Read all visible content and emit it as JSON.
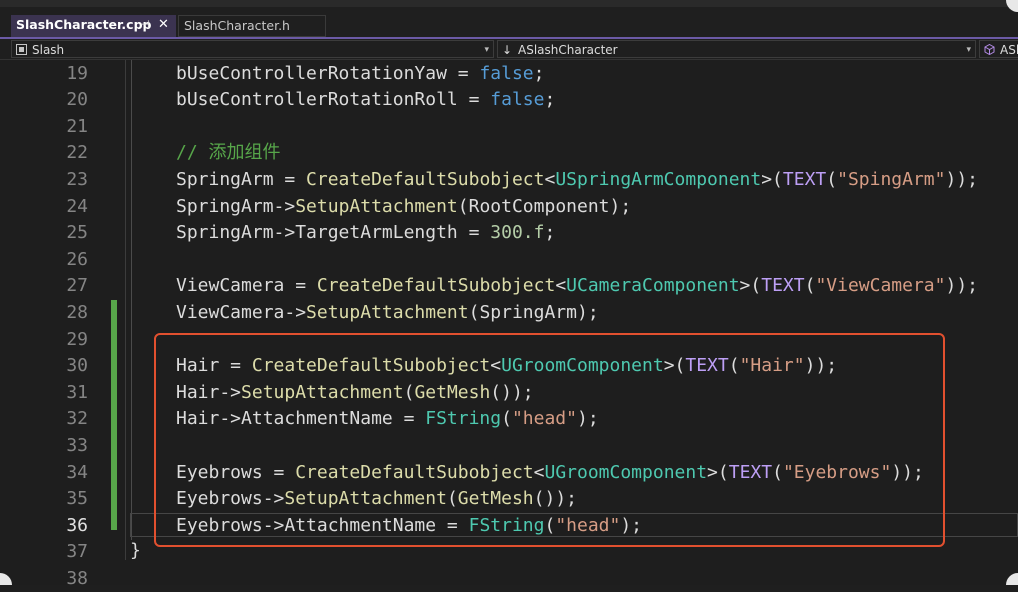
{
  "tabs": [
    {
      "label": "SlashCharacter.cpp",
      "pin_glyph": "⊣",
      "close_glyph": "✕",
      "active": true
    },
    {
      "label": "SlashCharacter.h",
      "active": false
    }
  ],
  "nav": {
    "project": "Slash",
    "scope": "ASlashCharacter",
    "scope_arrow": "↓",
    "member": "ASl",
    "dropdown_glyph": "▾"
  },
  "editor": {
    "closing_brace": "}",
    "lines": [
      {
        "n": "19",
        "code": "bUseControllerRotationYaw = false;"
      },
      {
        "n": "20",
        "code": "bUseControllerRotationRoll = false;"
      },
      {
        "n": "21",
        "code": ""
      },
      {
        "n": "22",
        "code": "// 添加组件"
      },
      {
        "n": "23",
        "code": "SpringArm = CreateDefaultSubobject<USpringArmComponent>(TEXT(\"SpingArm\"));"
      },
      {
        "n": "24",
        "code": "SpringArm->SetupAttachment(RootComponent);"
      },
      {
        "n": "25",
        "code": "SpringArm->TargetArmLength = 300.f;"
      },
      {
        "n": "26",
        "code": ""
      },
      {
        "n": "27",
        "code": "ViewCamera = CreateDefaultSubobject<UCameraComponent>(TEXT(\"ViewCamera\"));"
      },
      {
        "n": "28",
        "code": "ViewCamera->SetupAttachment(SpringArm);"
      },
      {
        "n": "29",
        "code": ""
      },
      {
        "n": "30",
        "code": "Hair = CreateDefaultSubobject<UGroomComponent>(TEXT(\"Hair\"));"
      },
      {
        "n": "31",
        "code": "Hair->SetupAttachment(GetMesh());"
      },
      {
        "n": "32",
        "code": "Hair->AttachmentName = FString(\"head\");"
      },
      {
        "n": "33",
        "code": ""
      },
      {
        "n": "34",
        "code": "Eyebrows = CreateDefaultSubobject<UGroomComponent>(TEXT(\"Eyebrows\"));"
      },
      {
        "n": "35",
        "code": "Eyebrows->SetupAttachment(GetMesh());"
      },
      {
        "n": "36",
        "code": "Eyebrows->AttachmentName = FString(\"head\");"
      },
      {
        "n": "37",
        "code": ""
      },
      {
        "n": "38",
        "code": ""
      }
    ]
  },
  "colors": {
    "keyword": "#569cd6",
    "function": "#dcdcaa",
    "type": "#4ec9b0",
    "string": "#d69d85",
    "number": "#b5cea8",
    "comment": "#57a64a",
    "macro": "#bd9ff5",
    "highlight_box": "#e2502f",
    "change_bar": "#57a64a"
  }
}
